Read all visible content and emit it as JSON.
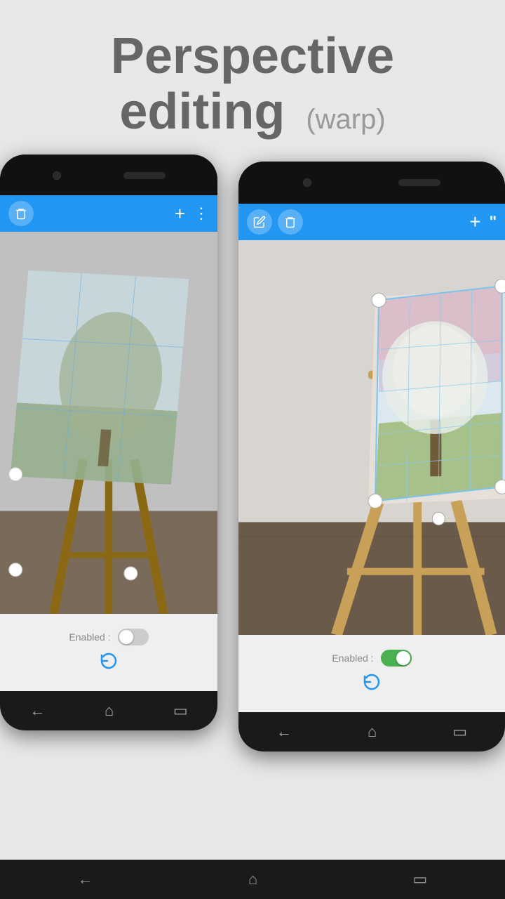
{
  "header": {
    "title_bold": "Perspective",
    "title_bold2": "editing",
    "title_light": "(warp)"
  },
  "phones": {
    "left": {
      "toolbar": {
        "icons": [
          "trash",
          "plus"
        ],
        "trash_label": "🗑",
        "plus_label": "+"
      },
      "bottom": {
        "enabled_label": "Enabled :",
        "toggle_state": "off",
        "reset_label": "↺"
      }
    },
    "right": {
      "toolbar": {
        "icons": [
          "edit",
          "trash",
          "plus",
          "quote"
        ],
        "edit_label": "✎",
        "trash_label": "🗑",
        "plus_label": "+",
        "quote_label": "\""
      },
      "bottom": {
        "enabled_label": "Enabled :",
        "toggle_state": "on",
        "reset_label": "↺"
      }
    }
  },
  "nav": {
    "back": "←",
    "home": "⌂",
    "recent": "▭"
  },
  "colors": {
    "toolbar_blue": "#2196F3",
    "toggle_on": "#4CAF50",
    "toggle_off": "#cccccc",
    "nav_bg": "#1a1a1a",
    "phone_bg": "#1a1a1a"
  }
}
